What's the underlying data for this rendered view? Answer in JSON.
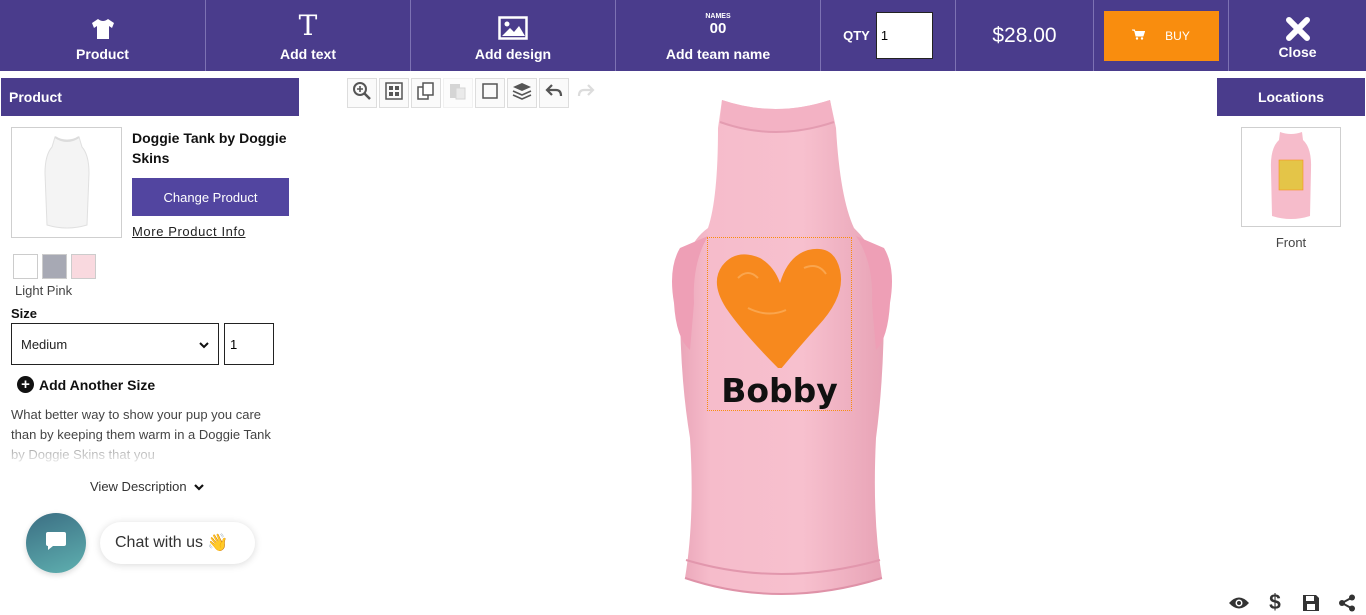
{
  "toolbar": {
    "product_label": "Product",
    "add_text_label": "Add text",
    "add_text_icon_glyph": "T",
    "add_design_label": "Add design",
    "add_team_label": "Add team name",
    "team_icon_top": "NAMES",
    "team_icon_num": "00",
    "qty_label": "QTY",
    "qty_value": "1",
    "price": "$28.00",
    "buy_label": "BUY",
    "close_label": "Close"
  },
  "product_panel": {
    "heading": "Product",
    "name": "Doggie Tank by Doggie Skins",
    "change_button": "Change Product",
    "more_info": "More Product Info",
    "colors": [
      {
        "name": "White",
        "hex": "#ffffff"
      },
      {
        "name": "Gray",
        "hex": "#a7a9b4"
      },
      {
        "name": "Light Pink",
        "hex": "#f9d9df"
      }
    ],
    "selected_color": "Light Pink",
    "size_label": "Size",
    "size_value": "Medium",
    "size_qty": "1",
    "add_size": "Add Another Size",
    "description": "What better way to show your pup you care than by keeping them warm in a Doggie Tank by Doggie Skins that you",
    "view_description": "View Description"
  },
  "chat": {
    "label": "Chat with us",
    "emoji": "👋"
  },
  "design": {
    "name_text": "Bobby",
    "heart_color": "#f7891e",
    "garment_color": "#f5b9c9"
  },
  "locations": {
    "heading": "Locations",
    "items": [
      {
        "label": "Front"
      }
    ]
  },
  "theme": {
    "brand": "#4a3c8c",
    "accent": "#f98d0e"
  }
}
